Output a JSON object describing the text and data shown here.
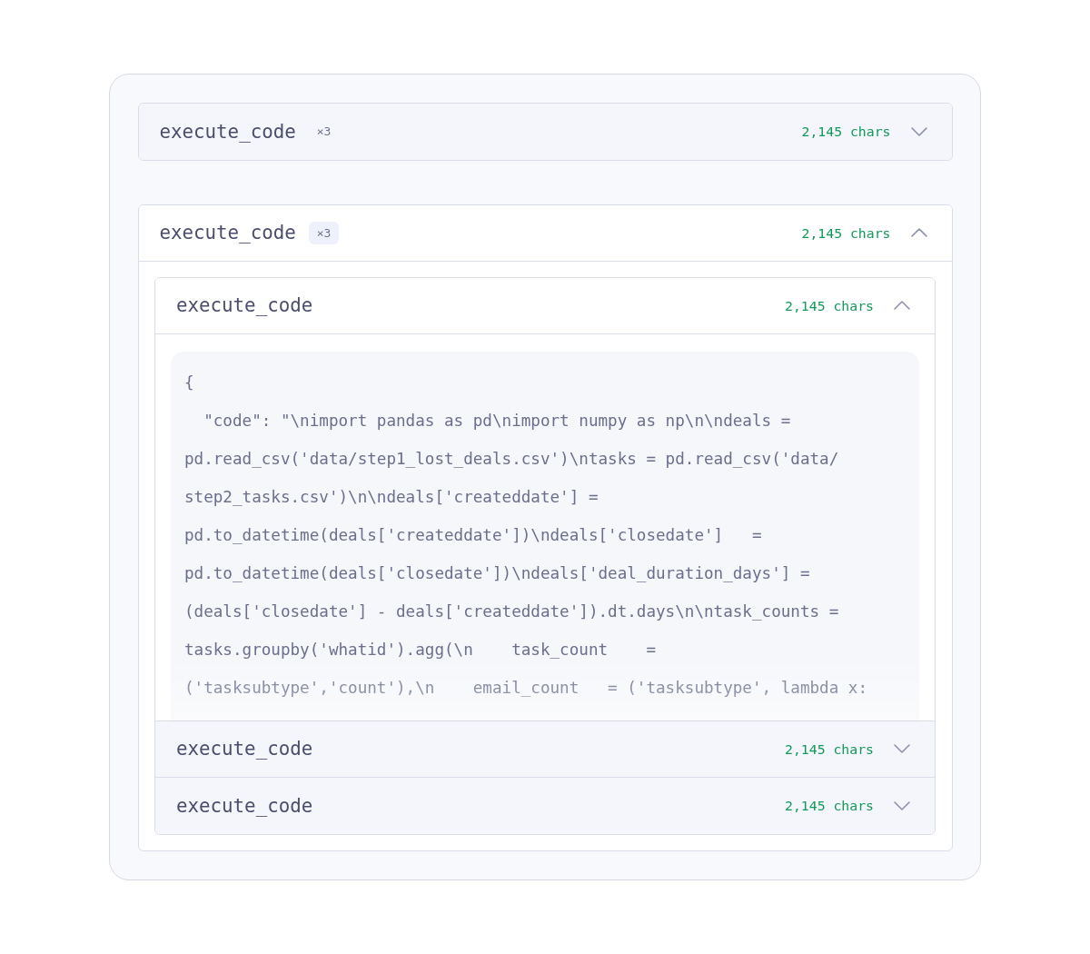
{
  "panel": {
    "groups": [
      {
        "title": "execute_code",
        "count": "×3",
        "chars": "2,145 chars",
        "expanded": false
      },
      {
        "title": "execute_code",
        "count": "×3",
        "chars": "2,145 chars",
        "expanded": true,
        "items": [
          {
            "title": "execute_code",
            "chars": "2,145 chars",
            "expanded": true,
            "code_lines": [
              "{",
              "  \"code\": \"\\nimport pandas as pd\\nimport numpy as np\\n\\ndeals =",
              "pd.read_csv('data/step1_lost_deals.csv')\\ntasks = pd.read_csv('data/",
              "step2_tasks.csv')\\n\\ndeals['createddate'] =",
              "pd.to_datetime(deals['createddate'])\\ndeals['closedate']   =",
              "pd.to_datetime(deals['closedate'])\\ndeals['deal_duration_days'] =",
              "(deals['closedate'] - deals['createddate']).dt.days\\n\\ntask_counts =",
              "tasks.groupby('whatid').agg(\\n    task_count    =",
              "('tasksubtype','count'),\\n    email_count   = ('tasksubtype', lambda x:"
            ]
          },
          {
            "title": "execute_code",
            "chars": "2,145 chars",
            "expanded": false
          },
          {
            "title": "execute_code",
            "chars": "2,145 chars",
            "expanded": false
          }
        ]
      }
    ]
  }
}
